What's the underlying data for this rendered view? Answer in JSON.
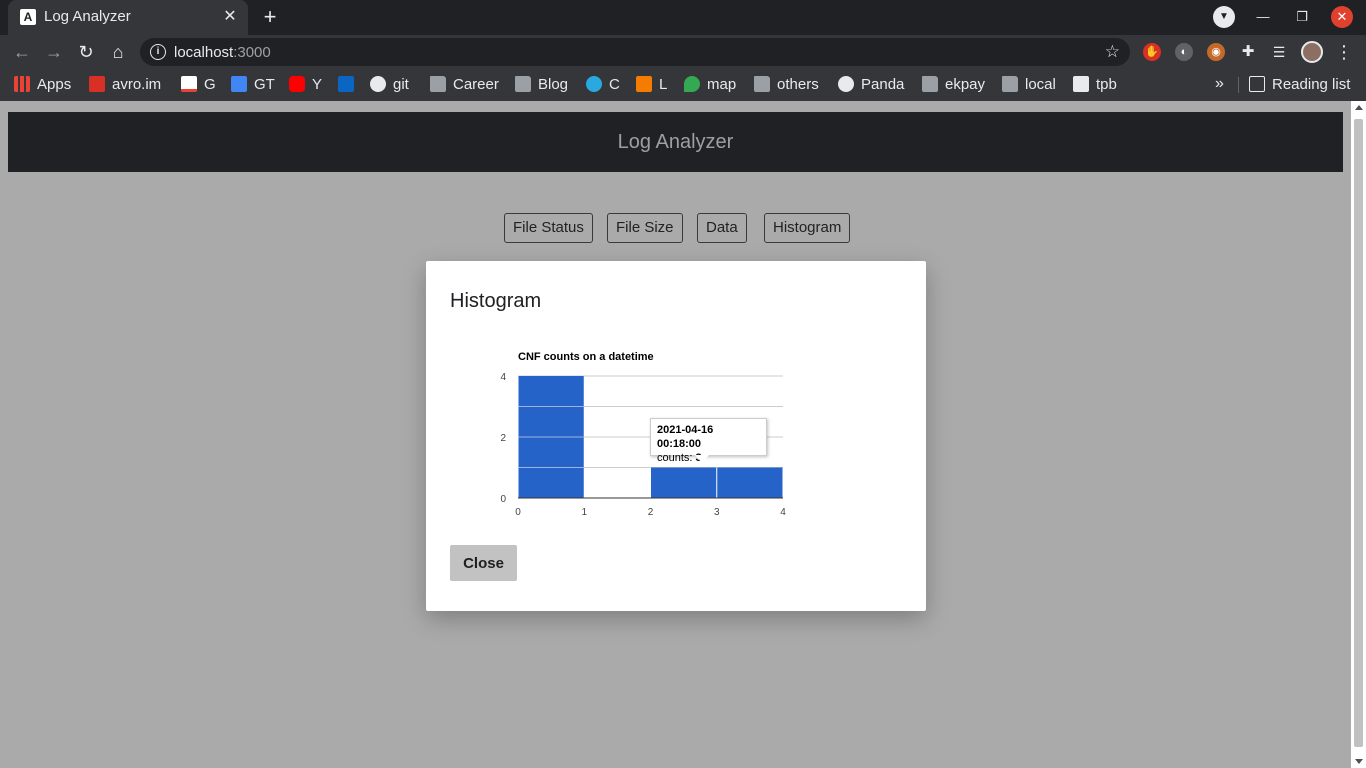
{
  "browser": {
    "tab_title": "Log Analyzer",
    "tab_favicon": "A",
    "new_tab_label": "+",
    "url_host": "localhost",
    "url_port": ":3000",
    "bookmarks": [
      {
        "label": "Apps",
        "icon": "apps-icon"
      },
      {
        "label": "avro.im",
        "icon": "avro-icon"
      },
      {
        "label": "G",
        "icon": "gmail-icon"
      },
      {
        "label": "GT",
        "icon": "google-translate-icon"
      },
      {
        "label": "Y",
        "icon": "youtube-icon"
      },
      {
        "label": "",
        "icon": "linkedin-icon"
      },
      {
        "label": "git",
        "icon": "github-icon"
      },
      {
        "label": "Career",
        "icon": "folder-icon"
      },
      {
        "label": "Blog",
        "icon": "folder-icon"
      },
      {
        "label": "C",
        "icon": "circle-icon"
      },
      {
        "label": "L",
        "icon": "leetcode-icon"
      },
      {
        "label": "map",
        "icon": "maps-icon"
      },
      {
        "label": "others",
        "icon": "folder-icon"
      },
      {
        "label": "Panda",
        "icon": "panda-icon"
      },
      {
        "label": "ekpay",
        "icon": "folder-icon"
      },
      {
        "label": "local",
        "icon": "folder-icon"
      },
      {
        "label": "tpb",
        "icon": "tpb-icon"
      }
    ],
    "more_bookmarks_label": "»",
    "reading_list_label": "Reading list"
  },
  "app": {
    "header_title": "Log Analyzer",
    "nav_buttons": [
      "File Status",
      "File Size",
      "Data",
      "Histogram"
    ]
  },
  "modal": {
    "title": "Histogram",
    "close_label": "Close"
  },
  "chart_data": {
    "type": "bar",
    "title": "CNF counts on a datetime",
    "xlabel": "",
    "ylabel": "",
    "xlim": [
      0,
      4
    ],
    "ylim": [
      0,
      4
    ],
    "x_ticks": [
      "0",
      "1",
      "2",
      "3",
      "4"
    ],
    "y_ticks": [
      "0",
      "2",
      "4"
    ],
    "bins": [
      {
        "x0": 0,
        "x1": 1,
        "value": 4
      },
      {
        "x0": 1,
        "x1": 2,
        "value": 0
      },
      {
        "x0": 2,
        "x1": 3,
        "value": 1
      },
      {
        "x0": 3,
        "x1": 4,
        "value": 1
      }
    ],
    "bar_color": "#2563c9",
    "grid": true,
    "tooltip": {
      "datetime": "2021-04-16 00:18:00",
      "label": "counts:",
      "value": "3"
    }
  },
  "colors": {
    "page_bg": "#aaaaaa",
    "header_bg": "#202124",
    "modal_bg": "#ffffff",
    "bar": "#2563c9"
  }
}
